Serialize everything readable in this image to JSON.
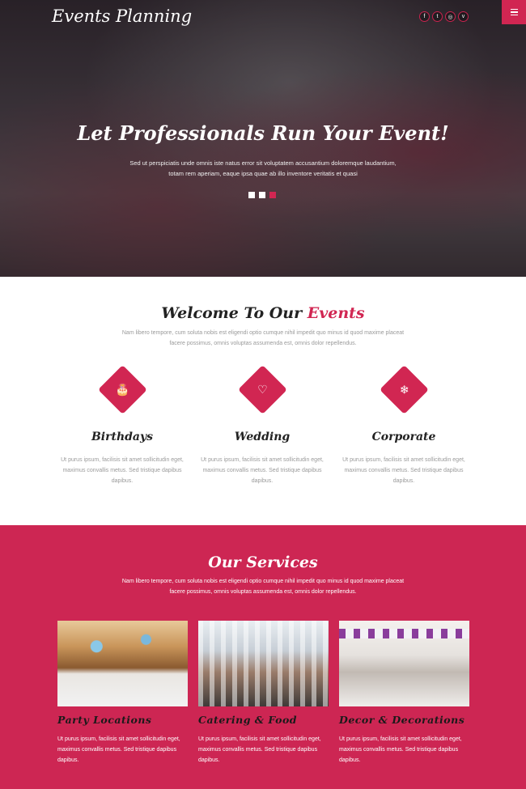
{
  "header": {
    "logo": "Events Planning",
    "social_icons": [
      "facebook-icon",
      "twitter-icon",
      "dribbble-icon",
      "vimeo-icon"
    ],
    "social_glyphs": [
      "f",
      "t",
      "◎",
      "v"
    ]
  },
  "hero": {
    "title": "Let Professionals Run Your Event!",
    "text": "Sed ut perspiciatis unde omnis iste natus error sit voluptatem accusantium doloremque laudantium, totam rem aperiam, eaque ipsa quae ab illo inventore veritatis et quasi",
    "slides": 3,
    "active_slide": 3
  },
  "welcome": {
    "title_prefix": "Welcome To Our ",
    "title_accent": "Events",
    "text": "Nam libero tempore, cum soluta nobis est eligendi optio cumque nihil impedit quo minus id quod maxime placeat facere possimus, omnis voluptas assumenda est, omnis dolor repellendus.",
    "features": [
      {
        "title": "Birthdays",
        "icon": "birthday-cake-icon",
        "glyph": "🎂",
        "text": "Ut purus ipsum, facilisis sit amet sollicitudin eget, maximus convallis metus. Sed tristique dapibus dapibus."
      },
      {
        "title": "Wedding",
        "icon": "heart-icon",
        "glyph": "♡",
        "text": "Ut purus ipsum, facilisis sit amet sollicitudin eget, maximus convallis metus. Sed tristique dapibus dapibus."
      },
      {
        "title": "Corporate",
        "icon": "snowflake-icon",
        "glyph": "❄",
        "text": "Ut purus ipsum, facilisis sit amet sollicitudin eget, maximus convallis metus. Sed tristique dapibus dapibus."
      }
    ]
  },
  "services": {
    "title": "Our Services",
    "text": "Nam libero tempore, cum soluta nobis est eligendi optio cumque nihil impedit quo minus id quod maxime placeat facere possimus, omnis voluptas assumenda est, omnis dolor repellendus.",
    "cards": [
      {
        "title": "Party Locations",
        "text": "Ut purus ipsum, facilisis sit amet sollicitudin eget, maximus convallis metus. Sed tristique dapibus dapibus."
      },
      {
        "title": "Catering & Food",
        "text": "Ut purus ipsum, facilisis sit amet sollicitudin eget, maximus convallis metus. Sed tristique dapibus dapibus."
      },
      {
        "title": "Decor & Decorations",
        "text": "Ut purus ipsum, facilisis sit amet sollicitudin eget, maximus convallis metus. Sed tristique dapibus dapibus."
      }
    ]
  },
  "colors": {
    "accent": "#cd2653",
    "white": "#ffffff"
  }
}
